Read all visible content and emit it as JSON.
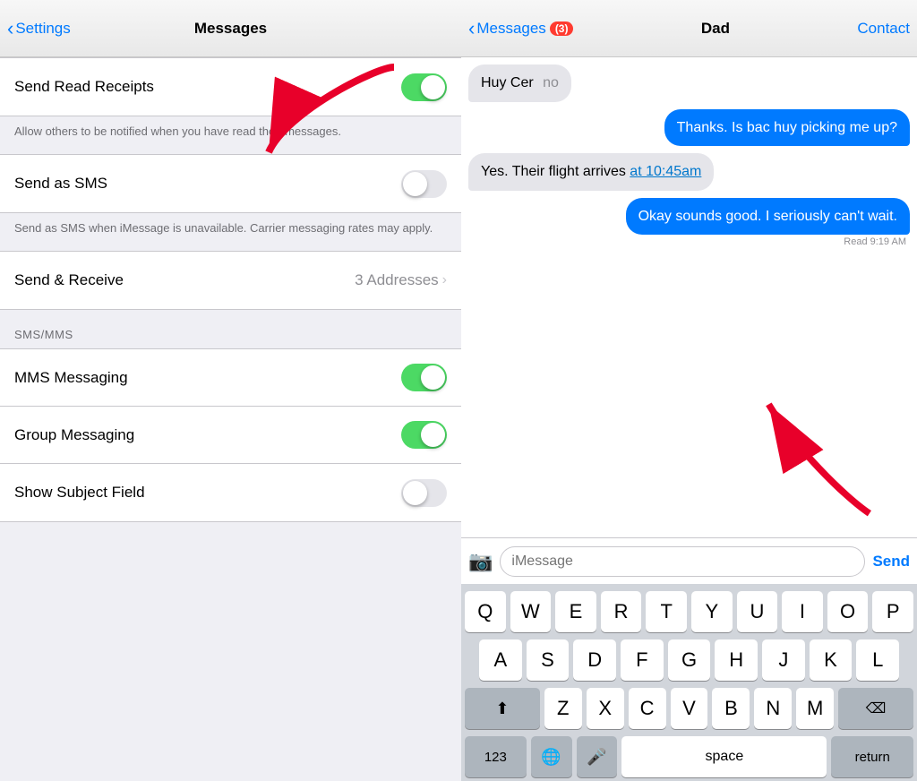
{
  "settings": {
    "back_label": "Settings",
    "title": "Messages",
    "rows": [
      {
        "id": "send-read-receipts",
        "label": "Send Read Receipts",
        "toggle": true,
        "description": "Allow others to be notified when you have read their messages."
      },
      {
        "id": "send-as-sms",
        "label": "Send as SMS",
        "toggle": false,
        "description": "Send as SMS when iMessage is unavailable. Carrier messaging rates may apply."
      },
      {
        "id": "send-receive",
        "label": "Send & Receive",
        "value": "3 Addresses",
        "hasChevron": true
      }
    ],
    "sms_section_header": "SMS/MMS",
    "sms_rows": [
      {
        "id": "mms-messaging",
        "label": "MMS Messaging",
        "toggle": true
      },
      {
        "id": "group-messaging",
        "label": "Group Messaging",
        "toggle": true
      },
      {
        "id": "show-subject-field",
        "label": "Show Subject Field",
        "toggle": false
      }
    ]
  },
  "messages": {
    "back_label": "Messages",
    "back_count": "(3)",
    "contact_name": "Dad",
    "contact_btn": "Contact",
    "bubbles": [
      {
        "id": "huy-cer",
        "type": "incoming",
        "text": "Huy Cer",
        "suffix": "no"
      },
      {
        "id": "thanks",
        "type": "outgoing",
        "text": "Thanks. Is bac huy picking me up?"
      },
      {
        "id": "flight",
        "type": "incoming",
        "text": "Yes. Their flight arrives ",
        "link": "at 10:45am"
      },
      {
        "id": "okay",
        "type": "outgoing",
        "text": "Okay sounds good. I seriously can't wait."
      }
    ],
    "read_status": "Read 9:19 AM",
    "input_placeholder": "iMessage",
    "send_label": "Send",
    "keyboard": {
      "rows": [
        [
          "Q",
          "W",
          "E",
          "R",
          "T",
          "Y",
          "U",
          "I",
          "O",
          "P"
        ],
        [
          "A",
          "S",
          "D",
          "F",
          "G",
          "H",
          "J",
          "K",
          "L"
        ],
        [
          "Z",
          "X",
          "C",
          "V",
          "B",
          "N",
          "M"
        ]
      ],
      "bottom": [
        "123",
        "🌐",
        "🎤",
        "space",
        "return"
      ]
    }
  }
}
